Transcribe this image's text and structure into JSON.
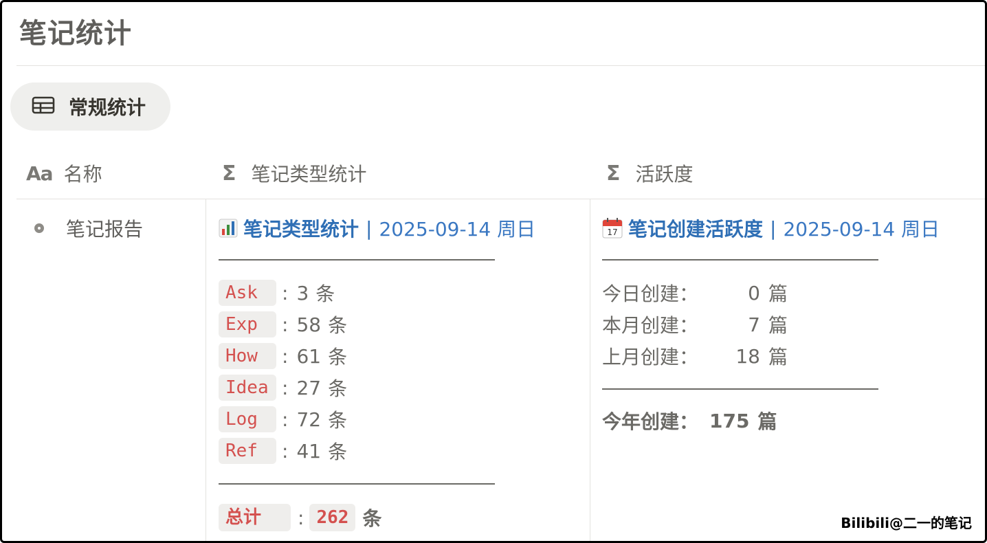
{
  "page": {
    "title": "笔记统计"
  },
  "view_tab": {
    "label": "常规统计",
    "icon": "table-icon"
  },
  "columns": [
    {
      "icon": "Aa",
      "label": "名称"
    },
    {
      "icon": "Σ",
      "label": "笔记类型统计"
    },
    {
      "icon": "Σ",
      "label": "活跃度"
    }
  ],
  "row": {
    "name": "笔记报告",
    "types": {
      "emoji": "bar-chart-emoji",
      "title": "笔记类型统计",
      "separator": "|",
      "date": "2025-09-14 周日",
      "items": [
        {
          "tag": "Ask",
          "colon": ":",
          "count": "3",
          "unit": "条"
        },
        {
          "tag": "Exp",
          "colon": ":",
          "count": "58",
          "unit": "条"
        },
        {
          "tag": "How",
          "colon": ":",
          "count": "61",
          "unit": "条"
        },
        {
          "tag": "Idea",
          "colon": ":",
          "count": "27",
          "unit": "条"
        },
        {
          "tag": "Log",
          "colon": ":",
          "count": "72",
          "unit": "条"
        },
        {
          "tag": "Ref",
          "colon": ":",
          "count": "41",
          "unit": "条"
        }
      ],
      "total": {
        "label": "总计",
        "colon": ":",
        "value": "262",
        "unit": "条"
      }
    },
    "activity": {
      "emoji": "calendar-emoji",
      "title": "笔记创建活跃度",
      "separator": "|",
      "date": "2025-09-14 周日",
      "items": [
        {
          "label": "今日创建：",
          "value": "0",
          "unit": "篇"
        },
        {
          "label": "本月创建：",
          "value": "7",
          "unit": "篇"
        },
        {
          "label": "上月创建：",
          "value": "18",
          "unit": "篇"
        }
      ],
      "year": {
        "label": "今年创建：",
        "value": "175",
        "unit": "篇"
      }
    }
  },
  "watermark": "Bilibili@二一的笔记",
  "colors": {
    "link_blue": "#2f6fb5",
    "code_red": "#d4514f",
    "tag_bg": "#efeeec",
    "muted_text": "#6b6a66"
  }
}
